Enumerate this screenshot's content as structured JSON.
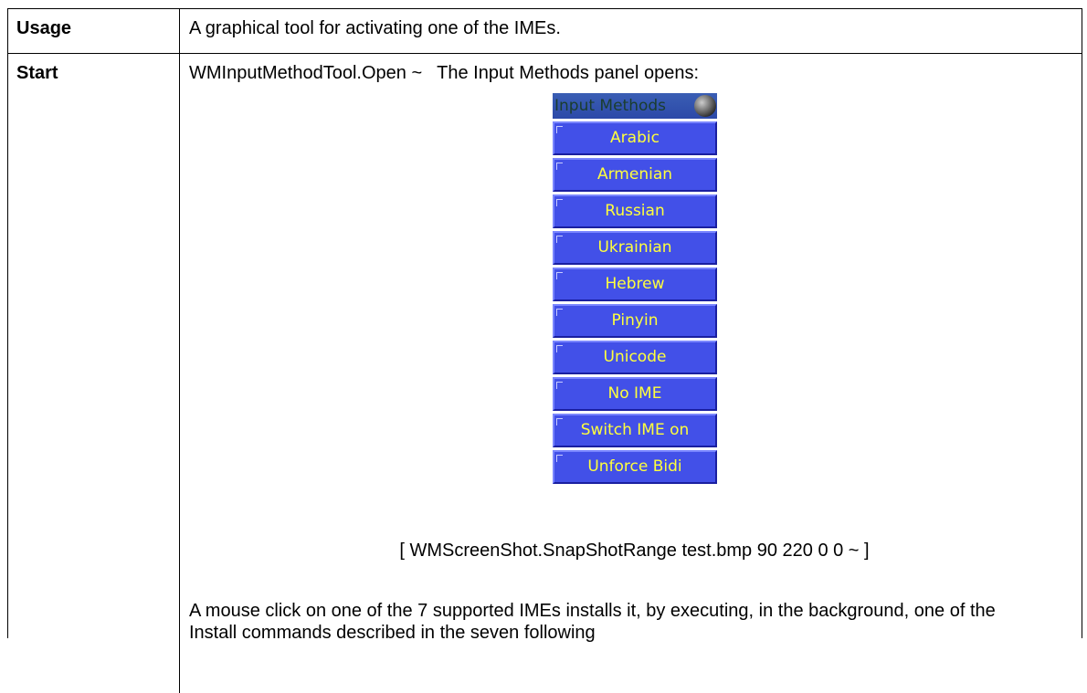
{
  "rows": {
    "usage": {
      "label": "Usage",
      "text": "A graphical tool for activating one of the IMEs."
    },
    "start": {
      "label": "Start",
      "command": "WMInputMethodTool.Open ~",
      "note": "The Input Methods panel opens:",
      "panel": {
        "title": "Input Methods",
        "items": [
          {
            "label": "Arabic"
          },
          {
            "label": "Armenian"
          },
          {
            "label": "Russian"
          },
          {
            "label": "Ukrainian"
          },
          {
            "label": "Hebrew"
          },
          {
            "label": "Pinyin"
          },
          {
            "label": "Unicode"
          },
          {
            "label": "No IME"
          },
          {
            "label": "Switch IME on"
          },
          {
            "label": "Unforce Bidi"
          }
        ],
        "colors": {
          "button_bg": "#4250e8",
          "button_text": "#ffff3c",
          "title_bg": "#2c49a8"
        }
      },
      "screenshot_command": "[ WMScreenShot.SnapShotRange test.bmp 90 220 0 0 ~ ]",
      "description": "A mouse click on one of the 7 supported IMEs installs it, by executing, in the background, one of the Install commands described in the seven following"
    }
  }
}
